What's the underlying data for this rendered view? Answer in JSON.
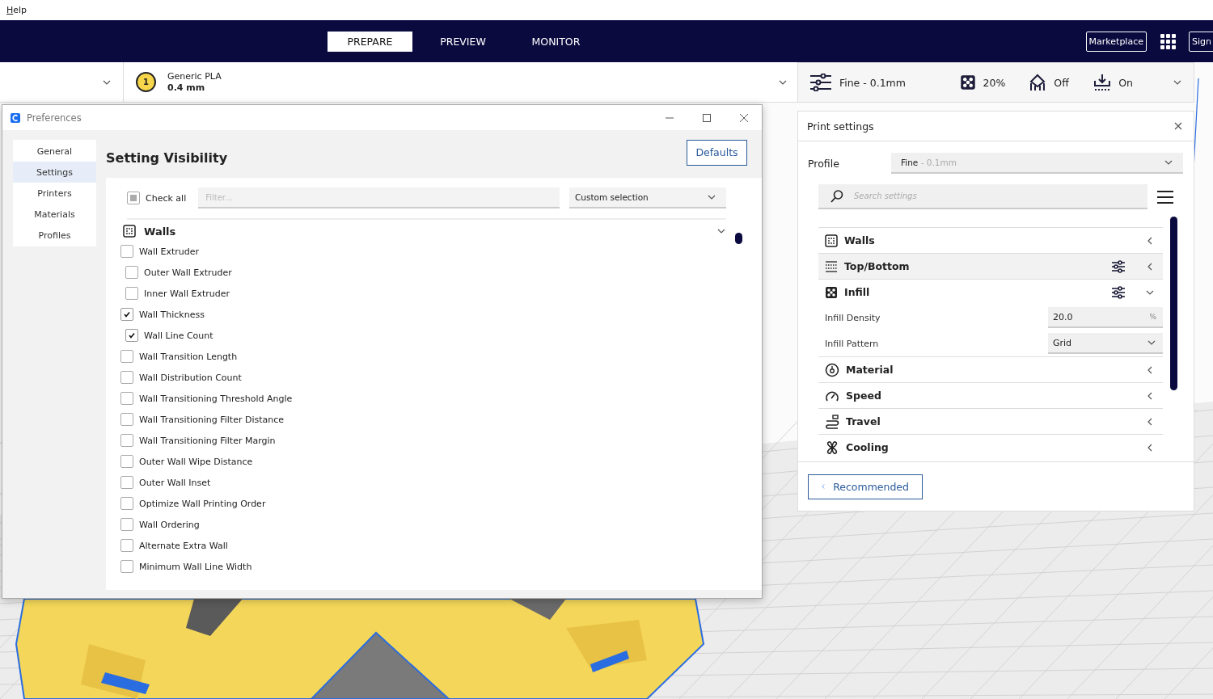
{
  "menu_bar": {
    "items": [
      "Help"
    ]
  },
  "header": {
    "tabs": [
      {
        "label": "PREPARE",
        "selected": true
      },
      {
        "label": "PREVIEW",
        "selected": false
      },
      {
        "label": "MONITOR",
        "selected": false
      }
    ],
    "marketplace": "Marketplace",
    "sign_in": "Sign"
  },
  "extruder": {
    "number": "1",
    "material": "Generic PLA",
    "nozzle": "0.4 mm"
  },
  "print_setup": {
    "profile": "Fine - 0.1mm",
    "infill": "20%",
    "support": "Off",
    "adhesion": "On"
  },
  "preferences": {
    "title": "Preferences",
    "nav": [
      {
        "label": "General",
        "selected": false
      },
      {
        "label": "Settings",
        "selected": true
      },
      {
        "label": "Printers",
        "selected": false
      },
      {
        "label": "Materials",
        "selected": false
      },
      {
        "label": "Profiles",
        "selected": false
      }
    ],
    "heading": "Setting Visibility",
    "defaults_button": "Defaults",
    "check_all": {
      "label": "Check all",
      "partial": true
    },
    "filter_placeholder": "Filter...",
    "preset": "Custom selection",
    "category": {
      "label": "Walls",
      "expanded": true
    },
    "items": [
      {
        "label": "Wall Extruder",
        "checked": false,
        "children": [
          {
            "label": "Outer Wall Extruder",
            "checked": false
          },
          {
            "label": "Inner Wall Extruder",
            "checked": false
          }
        ]
      },
      {
        "label": "Wall Thickness",
        "checked": true,
        "children": [
          {
            "label": "Wall Line Count",
            "checked": true
          }
        ]
      },
      {
        "label": "Wall Transition Length",
        "checked": false
      },
      {
        "label": "Wall Distribution Count",
        "checked": false
      },
      {
        "label": "Wall Transitioning Threshold Angle",
        "checked": false
      },
      {
        "label": "Wall Transitioning Filter Distance",
        "checked": false
      },
      {
        "label": "Wall Transitioning Filter Margin",
        "checked": false
      },
      {
        "label": "Outer Wall Wipe Distance",
        "checked": false
      },
      {
        "label": "Outer Wall Inset",
        "checked": false
      },
      {
        "label": "Optimize Wall Printing Order",
        "checked": false
      },
      {
        "label": "Wall Ordering",
        "checked": false
      },
      {
        "label": "Alternate Extra Wall",
        "checked": false
      },
      {
        "label": "Minimum Wall Line Width",
        "checked": false
      }
    ]
  },
  "print_settings": {
    "title": "Print settings",
    "profile_label": "Profile",
    "profile_name": "Fine",
    "profile_detail": "- 0.1mm",
    "search_placeholder": "Search settings",
    "categories": [
      {
        "label": "Walls",
        "expanded": false,
        "hovered": false,
        "customized": false
      },
      {
        "label": "Top/Bottom",
        "expanded": false,
        "hovered": true,
        "customized": true
      },
      {
        "label": "Infill",
        "expanded": true,
        "hovered": false,
        "customized": true,
        "settings": [
          {
            "kind": "number",
            "label": "Infill Density",
            "value": "20.0",
            "unit": "%"
          },
          {
            "kind": "dropdown",
            "label": "Infill Pattern",
            "value": "Grid"
          }
        ]
      },
      {
        "label": "Material",
        "expanded": false,
        "hovered": false,
        "customized": false
      },
      {
        "label": "Speed",
        "expanded": false,
        "hovered": false,
        "customized": false
      },
      {
        "label": "Travel",
        "expanded": false,
        "hovered": false,
        "customized": false
      },
      {
        "label": "Cooling",
        "expanded": false,
        "hovered": false,
        "customized": false
      }
    ],
    "recommended_button": "Recommended"
  }
}
